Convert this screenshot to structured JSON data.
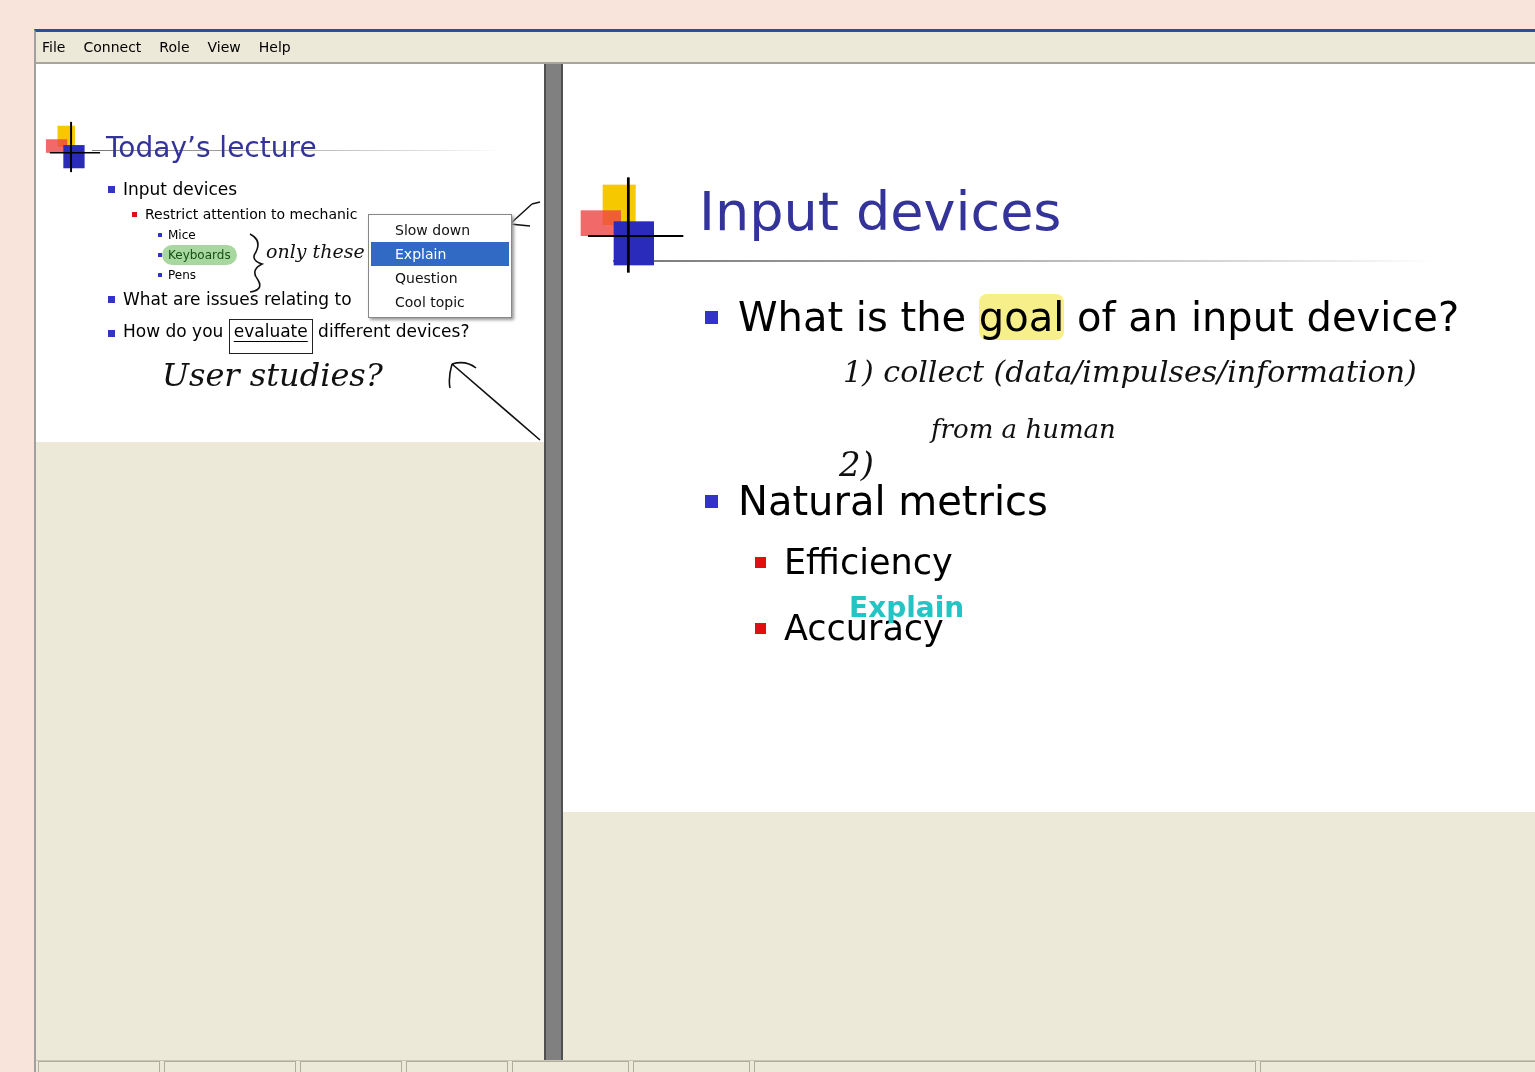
{
  "menu_bar": [
    "File",
    "Connect",
    "Role",
    "View",
    "Help"
  ],
  "thumbnail_slide": {
    "title": "Today’s lecture",
    "bullets": [
      {
        "text": "Input devices",
        "children": [
          {
            "text": "Restrict attention to mechanic",
            "children": [
              {
                "text": "Mice",
                "highlighted": false
              },
              {
                "text": "Keyboards",
                "highlighted": true
              },
              {
                "text": "Pens",
                "highlighted": false
              }
            ]
          }
        ]
      },
      {
        "text": "What are issues relating to"
      },
      {
        "segments": [
          {
            "text": "How do you ",
            "boxed": false
          },
          {
            "text": "evaluate",
            "boxed": true
          },
          {
            "text": " different devices?",
            "boxed": false
          }
        ]
      }
    ],
    "ink_notes": [
      "only these",
      "User studies?"
    ],
    "context_menu": [
      {
        "label": "Slow down",
        "selected": false
      },
      {
        "label": "Explain",
        "selected": true
      },
      {
        "label": "Question",
        "selected": false
      },
      {
        "label": "Cool topic",
        "selected": false
      }
    ]
  },
  "main_slide": {
    "title": "Input devices",
    "bullets": [
      {
        "segments": [
          {
            "text": "What is the ",
            "highlighted": false
          },
          {
            "text": "goal",
            "highlighted": true
          },
          {
            "text": " of an input device?",
            "highlighted": false
          }
        ]
      },
      {
        "segments": [
          {
            "text": "Natural metrics",
            "highlighted": false
          }
        ],
        "children": [
          {
            "text": "Efficiency"
          },
          {
            "text": "Accuracy"
          }
        ]
      }
    ],
    "ink_notes": [
      "1) collect (data/impulses/information)",
      "from a human",
      "2)"
    ],
    "stamp": "Explain"
  }
}
